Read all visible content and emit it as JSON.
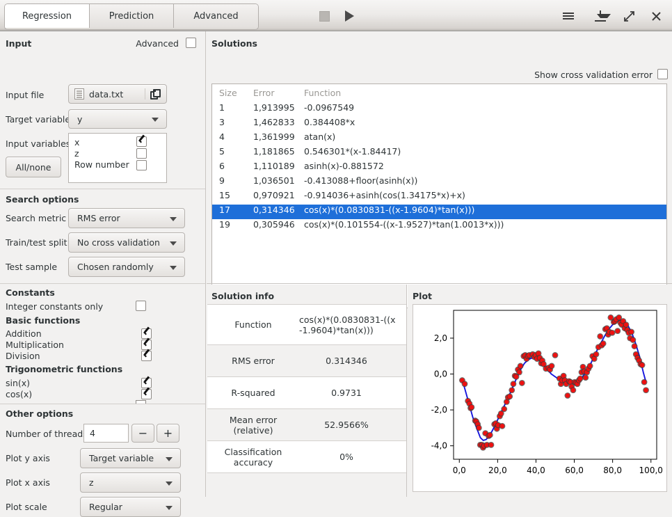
{
  "window": {
    "tabs": [
      {
        "label": "Regression",
        "active": true
      },
      {
        "label": "Prediction",
        "active": false
      },
      {
        "label": "Advanced",
        "active": false
      }
    ],
    "toolbar_icons": [
      "stop-icon",
      "play-icon",
      "menu-icon",
      "download-icon",
      "expand-icon",
      "close-icon"
    ]
  },
  "input": {
    "section_title": "Input",
    "advanced_label": "Advanced",
    "advanced_checked": false,
    "input_file_label": "Input file",
    "input_file_value": "data.txt",
    "target_variable_label": "Target variable",
    "target_variable_value": "y",
    "input_variables_label": "Input variables",
    "all_none_label": "All/none",
    "variables": [
      {
        "name": "x",
        "checked": true
      },
      {
        "name": "z",
        "checked": false
      },
      {
        "name": "Row number",
        "checked": false
      }
    ]
  },
  "search_options": {
    "section_title": "Search options",
    "search_metric_label": "Search metric",
    "search_metric_value": "RMS error",
    "train_test_split_label": "Train/test split",
    "train_test_split_value": "No cross validation",
    "test_sample_label": "Test sample",
    "test_sample_value": "Chosen randomly"
  },
  "constants": {
    "section_title": "Constants",
    "integer_only_label": "Integer constants only",
    "integer_only_checked": false,
    "basic_title": "Basic functions",
    "basic": [
      {
        "name": "Addition",
        "checked": true
      },
      {
        "name": "Multiplication",
        "checked": true
      },
      {
        "name": "Division",
        "checked": true
      }
    ],
    "trig_title": "Trigonometric functions",
    "trig": [
      {
        "name": "sin(x)",
        "checked": true
      },
      {
        "name": "cos(x)",
        "checked": true
      }
    ]
  },
  "other_options": {
    "section_title": "Other options",
    "threads_label": "Number of threads",
    "threads_value": "4",
    "minus_label": "−",
    "plus_label": "+",
    "plot_y_label": "Plot y axis",
    "plot_y_value": "Target variable",
    "plot_x_label": "Plot x axis",
    "plot_x_value": "z",
    "plot_scale_label": "Plot scale",
    "plot_scale_value": "Regular"
  },
  "solutions": {
    "title": "Solutions",
    "cross_validation_label": "Show cross validation error",
    "cross_validation_checked": false,
    "columns": [
      "Size",
      "Error",
      "Function"
    ],
    "rows": [
      {
        "size": "1",
        "error": "1,913995",
        "function": "-0.0967549",
        "selected": false
      },
      {
        "size": "3",
        "error": "1,462833",
        "function": "0.384408*x",
        "selected": false
      },
      {
        "size": "4",
        "error": "1,361999",
        "function": "atan(x)",
        "selected": false
      },
      {
        "size": "5",
        "error": "1,181865",
        "function": "0.546301*(x-1.84417)",
        "selected": false
      },
      {
        "size": "6",
        "error": "1,110189",
        "function": "asinh(x)-0.881572",
        "selected": false
      },
      {
        "size": "9",
        "error": "1,036501",
        "function": "-0.413088+floor(asinh(x))",
        "selected": false
      },
      {
        "size": "15",
        "error": "0,970921",
        "function": "-0.914036+asinh(cos(1.34175*x)+x)",
        "selected": false
      },
      {
        "size": "17",
        "error": "0,314346",
        "function": "cos(x)*(0.0830831-((x-1.9604)*tan(x)))",
        "selected": true
      },
      {
        "size": "19",
        "error": "0,305946",
        "function": "cos(x)*(0.101554-((x-1.9527)*tan(1.0013*x)))",
        "selected": false
      }
    ],
    "selection_color": "#1e6fd9"
  },
  "solution_info": {
    "title": "Solution info",
    "rows": [
      {
        "key": "Function",
        "value": "cos(x)*(0.0830831-((x-1.9604)*tan(x)))"
      },
      {
        "key": "RMS error",
        "value": "0.314346"
      },
      {
        "key": "R-squared",
        "value": "0.9731"
      },
      {
        "key": "Mean error (relative)",
        "value": "52.9566%"
      },
      {
        "key": "Classification accuracy",
        "value": "0%"
      }
    ]
  },
  "plot": {
    "title": "Plot"
  },
  "chart_data": {
    "type": "scatter",
    "title": "",
    "xlabel": "",
    "ylabel": "",
    "xlim": [
      -3,
      103
    ],
    "ylim": [
      -4.75,
      3.55
    ],
    "xticks": [
      0,
      20,
      40,
      60,
      80,
      100
    ],
    "xticklabels": [
      "0,0",
      "20,0",
      "40,0",
      "60,0",
      "80,0",
      "100,0"
    ],
    "yticks": [
      -4,
      -2,
      0,
      2
    ],
    "yticklabels": [
      "-4,0",
      "-2,0",
      "0,0",
      "2,0"
    ],
    "grid": false,
    "legend": false,
    "series": [
      {
        "name": "data",
        "type": "scatter",
        "marker_color": "#ee1111",
        "marker_edge": "#3a3a3a",
        "points": [
          [
            1.5,
            -0.35
          ],
          [
            2.8,
            -0.55
          ],
          [
            4.5,
            -1.5
          ],
          [
            5.3,
            -1.65
          ],
          [
            5.9,
            -1.9
          ],
          [
            6.4,
            -1.85
          ],
          [
            8.3,
            -2.6
          ],
          [
            8.9,
            -2.65
          ],
          [
            9.6,
            -2.8
          ],
          [
            10.2,
            -3.0
          ],
          [
            10.9,
            -3.95
          ],
          [
            11.8,
            -3.95
          ],
          [
            12.4,
            -4.1
          ],
          [
            12.9,
            -4.0
          ],
          [
            13.6,
            -3.3
          ],
          [
            14.4,
            -3.95
          ],
          [
            15.3,
            -3.45
          ],
          [
            16.0,
            -3.4
          ],
          [
            16.6,
            -3.95
          ],
          [
            18.3,
            -2.8
          ],
          [
            19.0,
            -2.75
          ],
          [
            19.6,
            -3.05
          ],
          [
            20.3,
            -2.85
          ],
          [
            21.1,
            -2.35
          ],
          [
            21.8,
            -2.2
          ],
          [
            22.4,
            -2.9
          ],
          [
            23.4,
            -1.95
          ],
          [
            24.7,
            -1.55
          ],
          [
            25.4,
            -1.3
          ],
          [
            26.3,
            -1.25
          ],
          [
            27.4,
            -0.9
          ],
          [
            28.2,
            -0.55
          ],
          [
            29.0,
            -0.1
          ],
          [
            29.7,
            -0.15
          ],
          [
            30.6,
            0.25
          ],
          [
            31.3,
            0.1
          ],
          [
            31.9,
            0.45
          ],
          [
            32.7,
            -0.5
          ],
          [
            33.6,
            1.0
          ],
          [
            34.4,
            1.05
          ],
          [
            35.1,
            0.85
          ],
          [
            35.8,
            1.0
          ],
          [
            36.5,
            1.05
          ],
          [
            38.3,
            1.1
          ],
          [
            39.2,
            0.95
          ],
          [
            39.9,
            1.05
          ],
          [
            40.6,
            0.85
          ],
          [
            41.3,
            1.15
          ],
          [
            42.0,
            0.9
          ],
          [
            42.7,
            0.6
          ],
          [
            43.3,
            0.75
          ],
          [
            44.0,
            0.55
          ],
          [
            45.2,
            0.3
          ],
          [
            46.6,
            0.35
          ],
          [
            47.3,
            0.25
          ],
          [
            48.2,
            0.45
          ],
          [
            50.0,
            1.05
          ],
          [
            52.3,
            -0.25
          ],
          [
            53.0,
            -0.55
          ],
          [
            53.7,
            -0.35
          ],
          [
            54.4,
            -0.1
          ],
          [
            55.1,
            -0.35
          ],
          [
            55.8,
            -0.55
          ],
          [
            56.5,
            -1.2
          ],
          [
            57.3,
            -0.4
          ],
          [
            58.0,
            -0.45
          ],
          [
            58.6,
            -0.7
          ],
          [
            59.4,
            -0.9
          ],
          [
            60.2,
            -0.45
          ],
          [
            60.9,
            -0.5
          ],
          [
            61.6,
            -0.55
          ],
          [
            62.4,
            -0.35
          ],
          [
            63.1,
            -0.25
          ],
          [
            63.8,
            0.1
          ],
          [
            64.5,
            0.4
          ],
          [
            65.2,
            0.15
          ],
          [
            65.9,
            -0.2
          ],
          [
            66.6,
            0.1
          ],
          [
            67.4,
            0.3
          ],
          [
            68.2,
            0.45
          ],
          [
            69.5,
            1.0
          ],
          [
            70.4,
            0.85
          ],
          [
            71.4,
            1.1
          ],
          [
            72.6,
            1.5
          ],
          [
            73.5,
            2.1
          ],
          [
            74.3,
            1.6
          ],
          [
            75.1,
            1.7
          ],
          [
            76.2,
            2.5
          ],
          [
            77.0,
            2.55
          ],
          [
            77.7,
            2.2
          ],
          [
            78.3,
            2.35
          ],
          [
            79.0,
            3.15
          ],
          [
            79.8,
            2.3
          ],
          [
            80.6,
            2.9
          ],
          [
            81.3,
            2.95
          ],
          [
            81.9,
            3.05
          ],
          [
            82.6,
            2.4
          ],
          [
            83.3,
            3.15
          ],
          [
            84.1,
            2.85
          ],
          [
            84.8,
            2.75
          ],
          [
            85.5,
            2.95
          ],
          [
            86.3,
            2.55
          ],
          [
            87.0,
            2.75
          ],
          [
            87.7,
            2.45
          ],
          [
            88.4,
            2.3
          ],
          [
            89.1,
            2.0
          ],
          [
            89.8,
            2.35
          ],
          [
            90.6,
            1.9
          ],
          [
            91.4,
            1.55
          ],
          [
            92.2,
            1.1
          ],
          [
            93.0,
            0.9
          ],
          [
            93.8,
            0.75
          ],
          [
            94.6,
            0.55
          ],
          [
            95.4,
            0.5
          ],
          [
            96.5,
            -0.45
          ],
          [
            97.4,
            -0.9
          ]
        ]
      },
      {
        "name": "fit",
        "type": "line",
        "color": "#1616dd",
        "points": [
          [
            1.5,
            -0.3
          ],
          [
            4,
            -1.25
          ],
          [
            7,
            -2.4
          ],
          [
            9,
            -3.0
          ],
          [
            11,
            -3.55
          ],
          [
            12.5,
            -3.7
          ],
          [
            14,
            -3.65
          ],
          [
            16,
            -3.4
          ],
          [
            18,
            -3.0
          ],
          [
            20,
            -2.55
          ],
          [
            22,
            -2.1
          ],
          [
            24,
            -1.65
          ],
          [
            26,
            -1.2
          ],
          [
            28,
            -0.7
          ],
          [
            30,
            -0.2
          ],
          [
            32,
            0.25
          ],
          [
            34,
            0.6
          ],
          [
            36,
            0.8
          ],
          [
            38,
            0.9
          ],
          [
            40,
            0.88
          ],
          [
            42,
            0.75
          ],
          [
            44,
            0.5
          ],
          [
            46,
            0.25
          ],
          [
            48,
            0.0
          ],
          [
            50,
            -0.15
          ],
          [
            52,
            -0.3
          ],
          [
            54,
            -0.4
          ],
          [
            56,
            -0.48
          ],
          [
            58,
            -0.5
          ],
          [
            60,
            -0.48
          ],
          [
            62,
            -0.4
          ],
          [
            64,
            -0.2
          ],
          [
            66,
            0.1
          ],
          [
            68,
            0.45
          ],
          [
            70,
            0.9
          ],
          [
            72,
            1.35
          ],
          [
            74,
            1.75
          ],
          [
            76,
            2.15
          ],
          [
            78,
            2.5
          ],
          [
            80,
            2.75
          ],
          [
            82,
            2.92
          ],
          [
            84,
            3.0
          ],
          [
            86,
            2.95
          ],
          [
            88,
            2.7
          ],
          [
            90,
            2.3
          ],
          [
            92,
            1.7
          ],
          [
            94,
            1.0
          ],
          [
            96,
            0.1
          ],
          [
            97.4,
            -0.45
          ]
        ]
      }
    ]
  }
}
